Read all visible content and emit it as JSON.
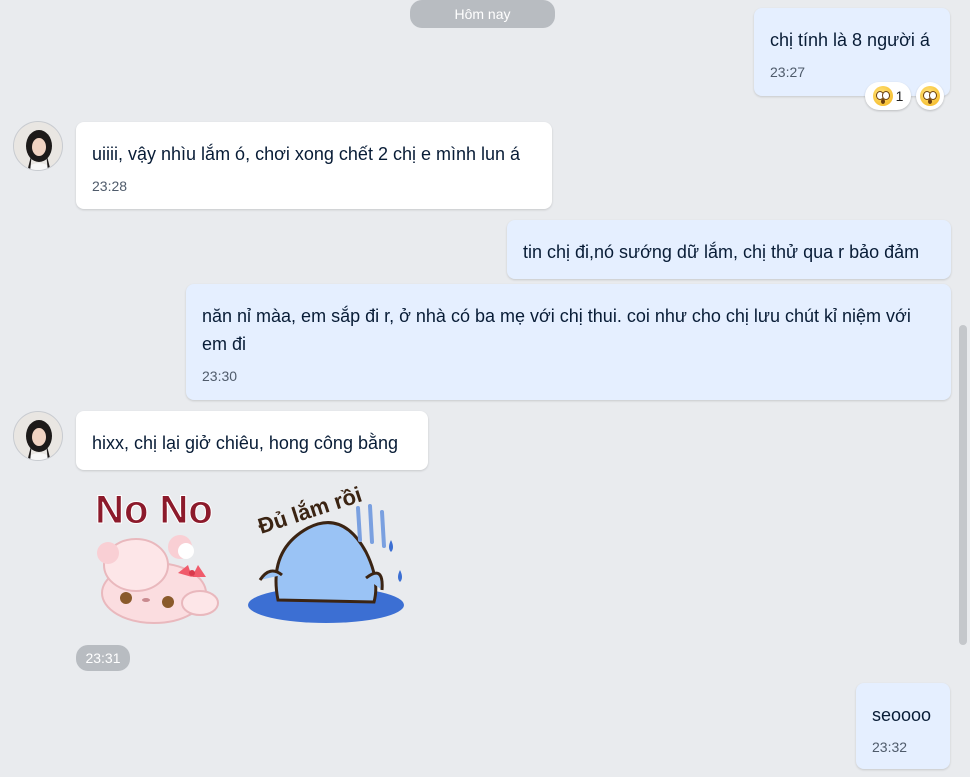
{
  "date_divider": "Hôm nay",
  "messages": [
    {
      "text": "chị tính là 8 người á",
      "time": "23:27"
    },
    {
      "text": "uiiii, vậy nhìu lắm ó, chơi xong chết 2 chị e mình lun á",
      "time": "23:28"
    },
    {
      "text": "tin chị đi,nó sướng dữ lắm, chị thử qua r bảo đảm"
    },
    {
      "text": "năn nỉ màa, em sắp đi r, ở nhà có ba mẹ với chị thui. coi như cho chị lưu chút kỉ niệm với em đi",
      "time": "23:30"
    },
    {
      "text": "hixx, chị lại giở chiêu, hong công bằng"
    },
    {
      "text": "seoooo",
      "time": "23:32"
    }
  ],
  "reactions": {
    "count": "1",
    "icon": "astonished-face-emoji"
  },
  "stickers": {
    "sticker1_text": "No No",
    "sticker2_text": "Đủ lắm rồi",
    "time": "23:31"
  }
}
